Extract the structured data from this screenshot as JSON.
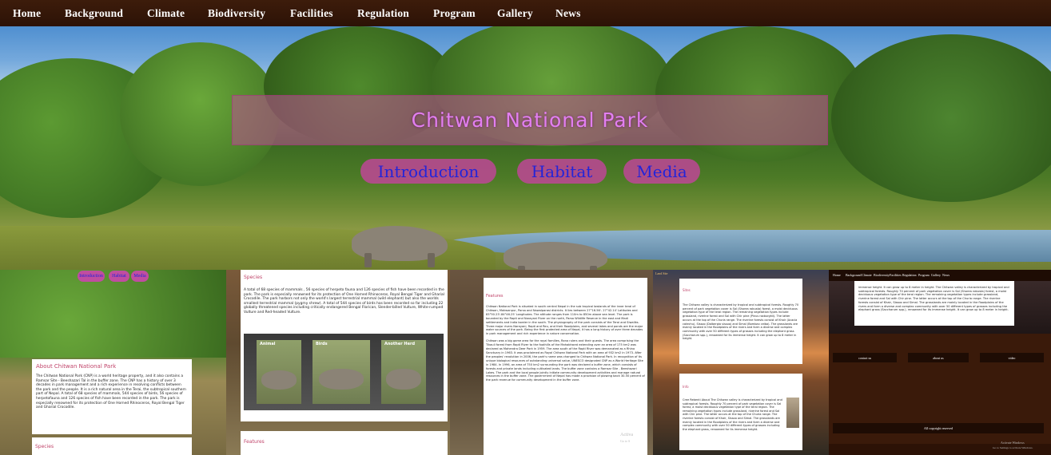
{
  "nav": {
    "items": [
      "Home",
      "Background",
      "Climate",
      "Biodiversity",
      "Facilities",
      "Regulation",
      "Program",
      "Gallery",
      "News"
    ]
  },
  "hero": {
    "title": "Chitwan National Park",
    "buttons": [
      "Introduction",
      "Habitat",
      "Media"
    ]
  },
  "thumb1": {
    "mini_buttons": [
      "Introduction",
      "Habitat",
      "Media"
    ],
    "heading": "About Chitwan National Park",
    "body": "The Chitwan National Park (CNP) is a world heritage property, and it also contains a Ramsar Site - Beeshazari Tal in the buffer zone. The CNP has a history of over 3 decades in park management and a rich experience in resolving conflicts between the park and the people. It is a rich natural area in the Terai, the subtropical southern part of Nepal. A total of 68 species of mammals, 544 species of birds, 56 species of herpetofauna and 126 species of fish have been recorded in the park. The park is especially renowned for its protection of One Horned Rhinoceros, Royal Bengal Tiger and Gharial Crocodile.",
    "footer_label": "Species"
  },
  "thumb2": {
    "heading": "Species",
    "body": "A total of 68 species of mammals , 56 species of herpeto fauna and 126 species of fish have been recorded in the park. The park is especially renowned for its protection of One Horned Rhinoceros, Royal Bengal Tiger and Gharial Crocodile. The park harbors not only the world's largest terrestrial mammal (wild elephant) but also the worlds smallest terrestrial mammal (pygmy shrew). A total of 544 species of birds has been recorded so far including 22 globally threatened species including critically endangered Bengal Florican, Slender-billed Vulture, White-rumped Vulture and Red-headed Vulture.",
    "gallery_labels": [
      "Animal",
      "Birds",
      "Another Herd"
    ],
    "footer_label": "Features"
  },
  "thumb3": {
    "heading": "Features",
    "para1": "Chitwan National Park is situated in south central Nepal in the sub tropical lowlands of the inner terai of Chitwan, Makwanpur, Parsa and Nawalparasi districts. It lies between 27°16.56'- 27°42.14' Latitudes and 83°50.23'-84°46.25' Longitudes. The altitude ranges from 110m to 850m above sea level. The park is bounded by the Rapti and Narayani River on the north, Parsa Wildlife Reserve in the east and Madi settlements and India border in the south. The physiography of the park consists of the Terai and Siwaliks. Three major rivers Narayani, Rapti and Reu, and their floodplains, and several lakes and ponds are the major water sources of the park. Being the first protected area of Nepal, it has a long history of over three decades in park management and rich experience in nature conservation.",
    "para2": "Chitwan was a big game area for the royal families, Rana rulers and their guests. The area comprising the Tikauli forest from Rapti River to the foothills of the Mahabharat extending over an area of 175 km2 was declared as Mahendra Deer Park in 1959. The area south of the Rapti River was demarcated as a Rhino Sanctuary in 1963. It was proclaimed as Royal Chitwan National Park with an area of 932 km2 in 1973. After the peoples' revolution in 2006, the park's name was changed to Chitwan National Park. In recognition of its unique biological resources of outstanding universal value, UNESCO designated CNP as a World Heritage Site in 1984. In 1996, an area of 750 km2 surrounding the park was declared a buffer zone, which consists of forests and private lands including cultivated lands. The buffer zone contains a Ramsar Site - Beeshazari Lakes. The park and the local people jointly initiate community development activities and manage natural resources in the buffer zone. The government of Nepal has made a provision of plowing back 30-50 percent of the park revenue for community development in the buffer zone.",
    "watermark": "Activa",
    "watermark2": "Go to S"
  },
  "thumb4": {
    "heading_top": "Land Site",
    "card1_heading": "Sites",
    "card1_body": "The Chitwan valley is characterized by tropical and subtropical forests. Roughly 70 percent of park vegetation cover is Sal (Shorea robusta) forest, a moist deciduous vegetation type of the terai region. The remaining vegetation types include grassland, riverine forest and Sal with Chir pine (Pinus roxburghii). The latter occurs at the top of the Churia range. The riverine forests consist of Khair (Acacia catechu), Sissoo (Dalbergia sissoo) and Simal (Bombax ceiba). The grasslands are mainly located in the floodplains of the rivers and form a diverse and complex community with over 50 different types of grasses including the elephant grass (Saccharum spp.), renowned for its immense height. It can grow up to 8 meter in height.",
    "card2_heading": "Info",
    "card2_body": "Cree Rebenti About The Chitwan valley is characterized by tropical and subtropical forests. Roughly 70 percent of park vegetation cover is Sal forest, a moist deciduous vegetation type of the terai region. The remaining vegetation types include grassland, riverine forest and Sal with Chir pine. The latter occurs at the top of the Churia range. The riverine forests consist of Khair, Sissoo and Simal. The grasslands are mainly located in the floodplains of the rivers and form a diverse and complex community with over 50 different types of grasses including the elephant grass, renowned for its immense height."
  },
  "thumb5": {
    "nav": [
      "Home",
      "Background",
      "Climate",
      "Biodiversity",
      "Facilities",
      "Regulation",
      "Program",
      "Gallery",
      "News"
    ],
    "body": "immense height. It can grow up to 8 meter in height. The Chitwan valley is characterized by tropical and subtropical forests. Roughly 70 percent of park vegetation cover is Sal (Shorea robusta) forest, a moist deciduous vegetation type of the terai region. The remaining vegetation types include grassland, riverine forest and Sal with Chir pine. The latter occurs at the top of the Churia range. The riverine forests consist of Khair, Sissoo and Simal. The grasslands are mainly located in the floodplains of the rivers and form a diverse and complex community with over 50 different types of grasses including the elephant grass (Saccharum spp.), renowned for its immense height. It can grow up to 8 meter in height.",
    "footer_links": [
      "contact us",
      "about us",
      "video"
    ],
    "copyright": "All copyright reserved",
    "watermark": "Activate Windows",
    "watermark2": "Go to Settings to activate Windows."
  }
}
